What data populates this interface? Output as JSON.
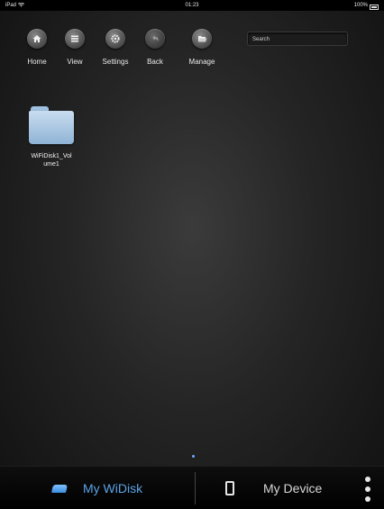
{
  "status_bar": {
    "carrier": "iPad",
    "time": "01:23",
    "battery": "100%"
  },
  "toolbar": {
    "items": [
      {
        "label": "Home",
        "icon": "home-icon"
      },
      {
        "label": "View",
        "icon": "view-icon"
      },
      {
        "label": "Settings",
        "icon": "settings-icon"
      },
      {
        "label": "Back",
        "icon": "back-icon"
      },
      {
        "label": "Manage",
        "icon": "manage-icon"
      }
    ],
    "search_placeholder": "Search"
  },
  "files": [
    {
      "name": "WiFiDisk1_Volume1",
      "icon": "folder-icon"
    }
  ],
  "tabbar": {
    "tabs": [
      {
        "label": "My WiDisk",
        "icon": "disk-icon",
        "selected": true
      },
      {
        "label": "My Device",
        "icon": "device-icon",
        "selected": false
      }
    ],
    "more_icon": "more-vertical-icon"
  },
  "colors": {
    "accent": "#5aa3e8",
    "background": "#252525",
    "folder": "#a9c8e6"
  }
}
